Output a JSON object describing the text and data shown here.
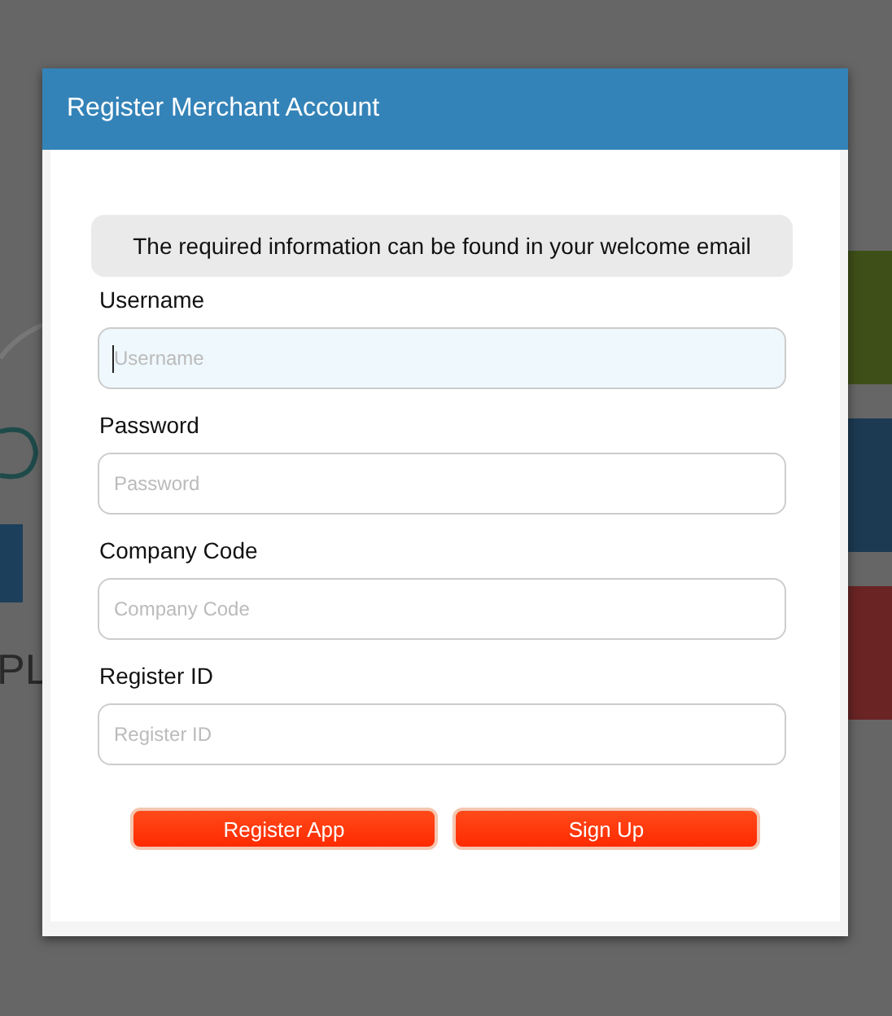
{
  "background": {
    "text": "PL",
    "tiles": [
      {
        "color": "#3e5018"
      },
      {
        "color": "#1c3a52"
      },
      {
        "color": "#6a2424"
      }
    ]
  },
  "dialog": {
    "title": "Register Merchant Account",
    "notice": "The required information can be found in your welcome email",
    "fields": [
      {
        "label": "Username",
        "placeholder": "Username",
        "focused": true
      },
      {
        "label": "Password",
        "placeholder": "Password",
        "focused": false
      },
      {
        "label": "Company Code",
        "placeholder": "Company Code",
        "focused": false
      },
      {
        "label": "Register ID",
        "placeholder": "Register ID",
        "focused": false
      }
    ],
    "buttons": [
      "Register App",
      "Sign Up"
    ]
  }
}
